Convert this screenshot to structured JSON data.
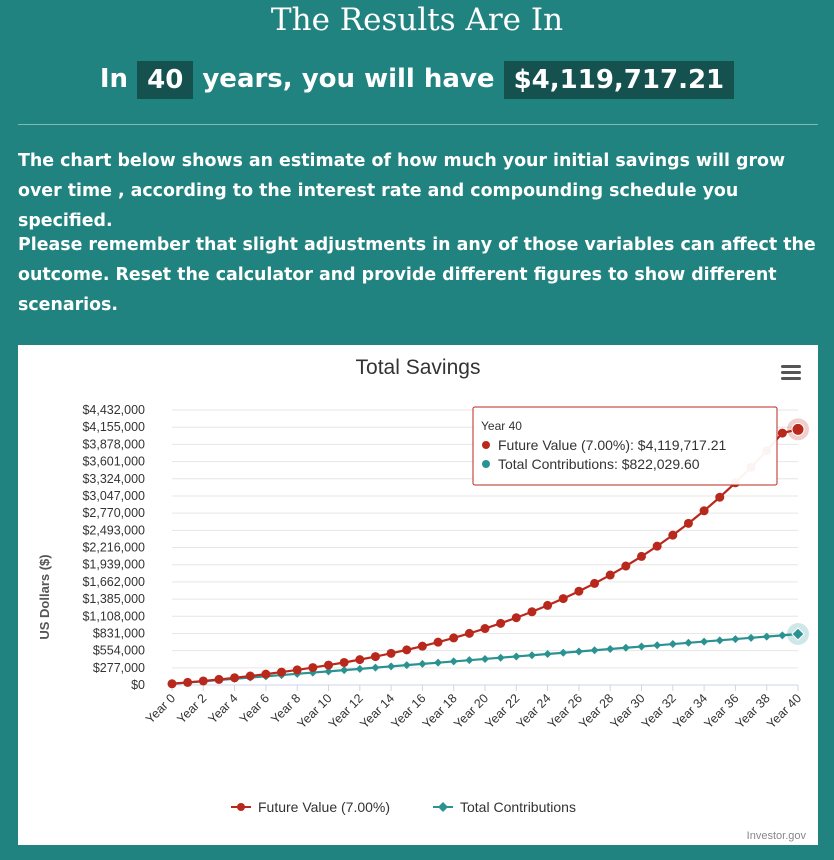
{
  "header": {
    "title": "The Results Are In",
    "prefix": "In",
    "years": "40",
    "middle": "years, you will have",
    "amount": "$4,119,717.21"
  },
  "paragraphs": {
    "p1": "The chart below shows an estimate of how much your initial savings will grow over time , according to the interest rate and compounding schedule you specified.",
    "p2": "Please remember that slight adjustments in any of those variables can affect the outcome. Reset the calculator and provide different figures to show different scenarios."
  },
  "colors": {
    "background": "#218380",
    "future_value": "#b8281c",
    "contributions": "#2a9391"
  },
  "chart_data": {
    "type": "line",
    "title": "Total Savings",
    "ylabel": "US Dollars ($)",
    "xlabel": "",
    "ylim": [
      0,
      4432000
    ],
    "y_ticks": [
      "$0",
      "$277,000",
      "$554,000",
      "$831,000",
      "$1,108,000",
      "$1,385,000",
      "$1,662,000",
      "$1,939,000",
      "$2,216,000",
      "$2,493,000",
      "$2,770,000",
      "$3,047,000",
      "$3,324,000",
      "$3,601,000",
      "$3,878,000",
      "$4,155,000",
      "$4,432,000"
    ],
    "x": [
      "Year 0",
      "Year 1",
      "Year 2",
      "Year 3",
      "Year 4",
      "Year 5",
      "Year 6",
      "Year 7",
      "Year 8",
      "Year 9",
      "Year 10",
      "Year 11",
      "Year 12",
      "Year 13",
      "Year 14",
      "Year 15",
      "Year 16",
      "Year 17",
      "Year 18",
      "Year 19",
      "Year 20",
      "Year 21",
      "Year 22",
      "Year 23",
      "Year 24",
      "Year 25",
      "Year 26",
      "Year 27",
      "Year 28",
      "Year 29",
      "Year 30",
      "Year 31",
      "Year 32",
      "Year 33",
      "Year 34",
      "Year 35",
      "Year 36",
      "Year 37",
      "Year 38",
      "Year 39",
      "Year 40"
    ],
    "x_tick_labels": [
      "Year 0",
      "Year 2",
      "Year 4",
      "Year 6",
      "Year 8",
      "Year 10",
      "Year 12",
      "Year 14",
      "Year 16",
      "Year 18",
      "Year 20",
      "Year 22",
      "Year 24",
      "Year 26",
      "Year 28",
      "Year 30",
      "Year 32",
      "Year 34",
      "Year 36",
      "Year 38",
      "Year 40"
    ],
    "series": [
      {
        "name": "Future Value (7.00%)",
        "color": "#b8281c",
        "marker": "circle",
        "values": [
          20000,
          41800,
          65000,
          90000,
          116000,
          145000,
          175000,
          208000,
          243000,
          281000,
          321000,
          363000,
          409000,
          458000,
          510000,
          566000,
          626000,
          690000,
          759000,
          832000,
          910000,
          994000,
          1084000,
          1180000,
          1283000,
          1393000,
          1511000,
          1637000,
          1772000,
          1917000,
          2072000,
          2238000,
          2415000,
          2605000,
          2808000,
          3026000,
          3259000,
          3508000,
          3775000,
          4060000,
          4119717.21
        ]
      },
      {
        "name": "Total Contributions",
        "color": "#2a9391",
        "marker": "diamond",
        "values": [
          20000,
          40000,
          60000,
          80000,
          100000,
          120000,
          140000,
          160000,
          180000,
          200000,
          220000,
          240000,
          260000,
          280000,
          300000,
          320000,
          340000,
          360000,
          380000,
          400000,
          420000,
          440000,
          460000,
          480000,
          500000,
          520000,
          540000,
          560000,
          580000,
          600000,
          620000,
          640000,
          660000,
          680000,
          700000,
          720000,
          740000,
          760000,
          780000,
          800000,
          822029.6
        ]
      }
    ],
    "tooltip": {
      "title": "Year 40",
      "line1": "Future Value (7.00%): $4,119,717.21",
      "line2": "Total Contributions: $822,029.60"
    },
    "legend_position": "bottom",
    "grid": true,
    "credits": "Investor.gov"
  }
}
